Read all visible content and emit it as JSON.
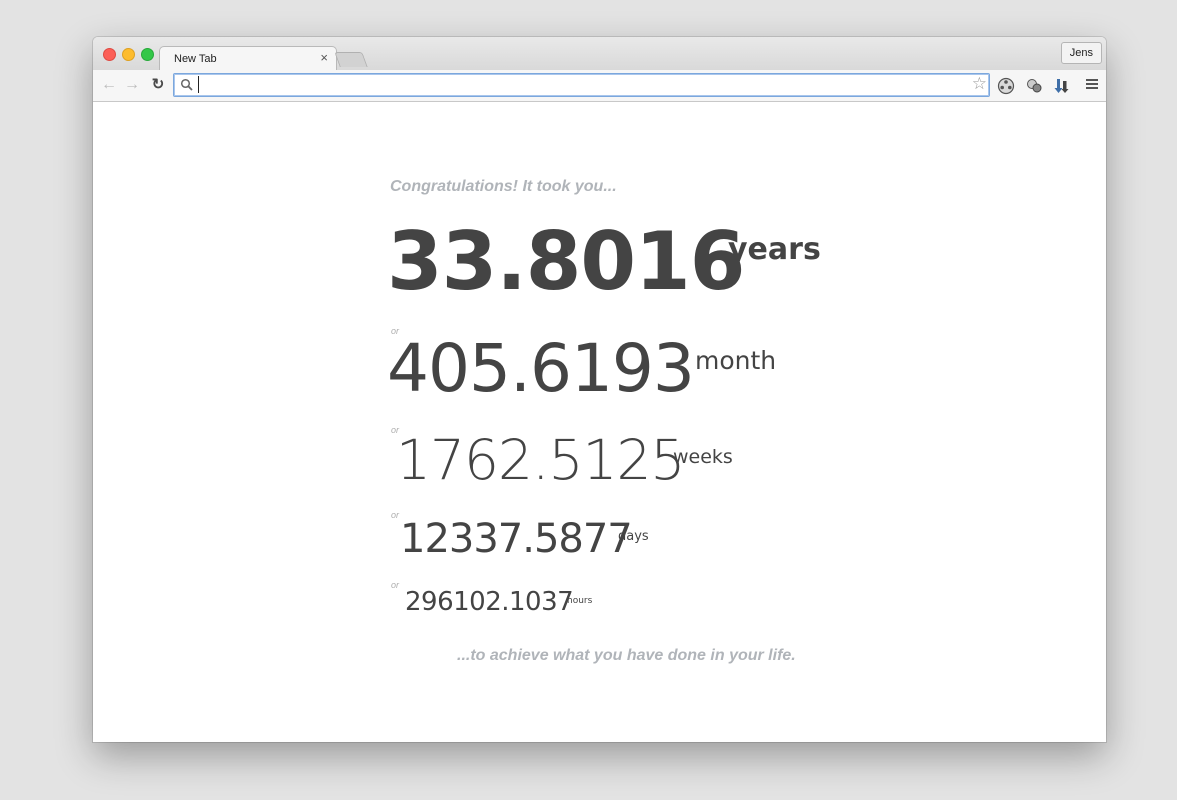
{
  "browser": {
    "tab_title": "New Tab",
    "tab_close": "×",
    "profile_name": "Jens",
    "address_value": "",
    "icons": {
      "back": "arrow-left",
      "forward": "arrow-right",
      "reload": "reload",
      "search": "magnifier",
      "star": "star-outline",
      "menu": "hamburger"
    }
  },
  "page": {
    "intro": "Congratulations! It took you...",
    "or_label": "or",
    "stats": [
      {
        "value": "33.8016",
        "unit": "years"
      },
      {
        "value": "405.6193",
        "unit": "month"
      },
      {
        "value": "1762.5125",
        "unit": "weeks"
      },
      {
        "value": "12337.5877",
        "unit": "days"
      },
      {
        "value": "296102.1037",
        "unit": "hours"
      }
    ],
    "outro": "...to achieve what you have done in your life."
  },
  "colors": {
    "text_dark": "#444444",
    "text_muted": "#b0b4b9",
    "omnibox_focus": "#7ba7dd"
  }
}
